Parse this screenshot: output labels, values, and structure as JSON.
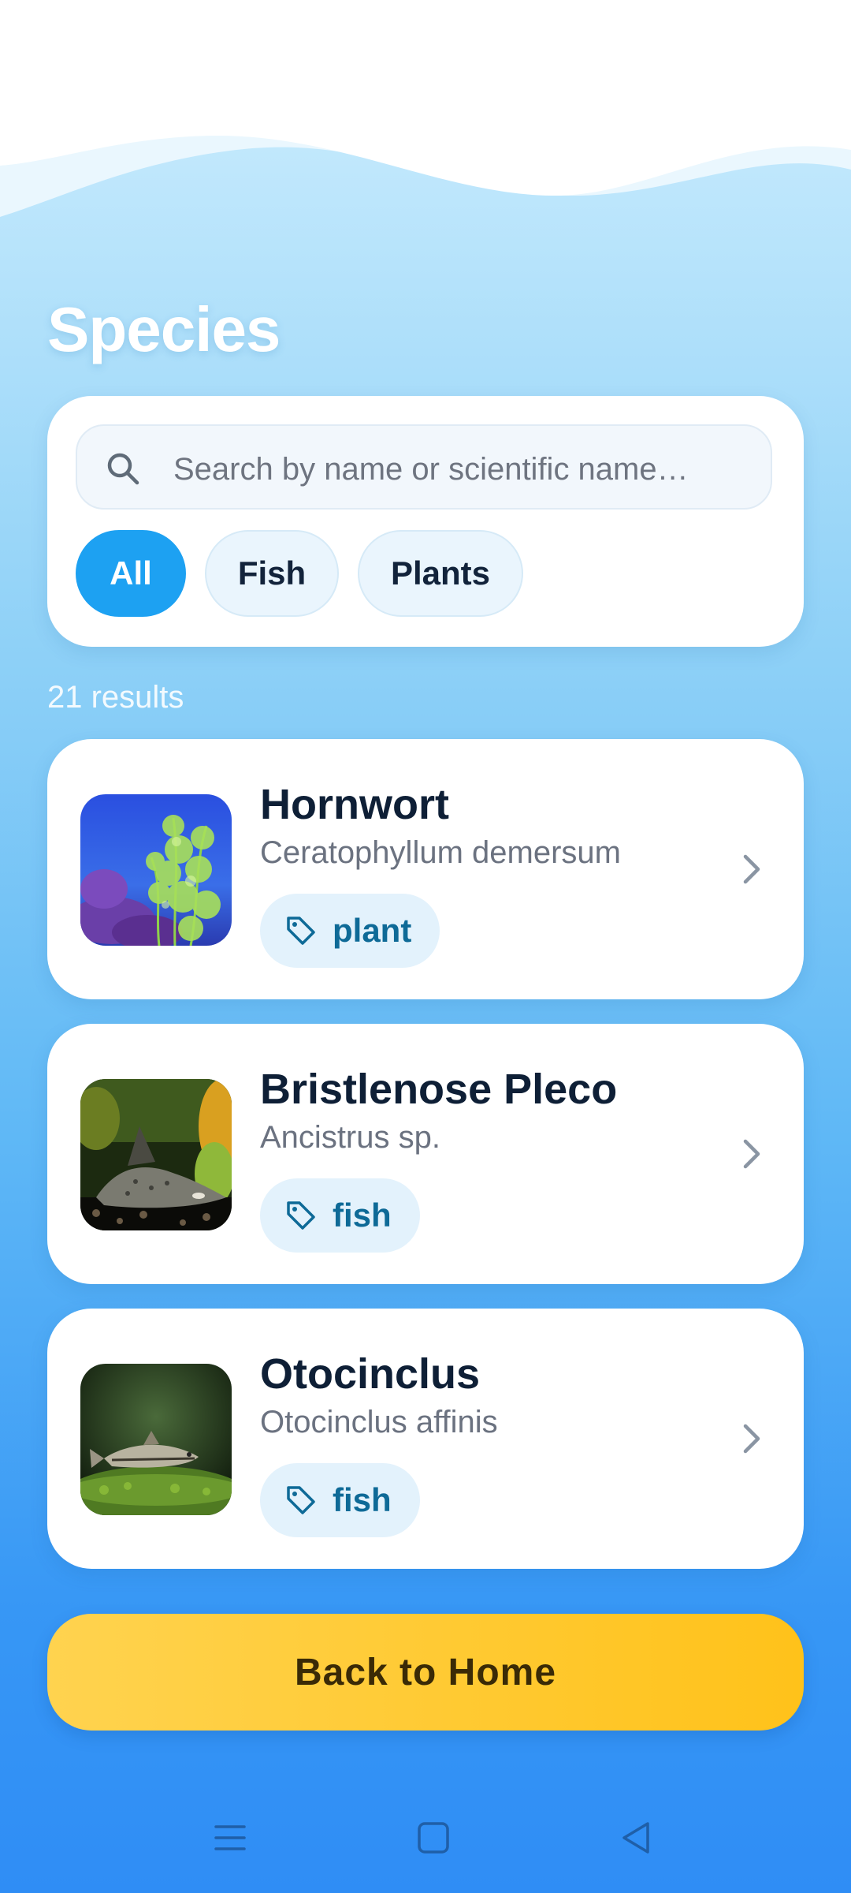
{
  "header": {
    "title": "Species"
  },
  "search": {
    "placeholder": "Search by name or scientific name…",
    "value": ""
  },
  "filters": [
    {
      "label": "All",
      "active": true
    },
    {
      "label": "Fish",
      "active": false
    },
    {
      "label": "Plants",
      "active": false
    }
  ],
  "results": {
    "count_text": "21 results",
    "items": [
      {
        "name": "Hornwort",
        "scientific": "Ceratophyllum demersum",
        "tag": "plant"
      },
      {
        "name": "Bristlenose Pleco",
        "scientific": "Ancistrus sp.",
        "tag": "fish"
      },
      {
        "name": "Otocinclus",
        "scientific": "Otocinclus affinis",
        "tag": "fish"
      }
    ]
  },
  "actions": {
    "back_label": "Back to Home"
  },
  "icons": {
    "search": "search-icon",
    "tag": "tag-icon",
    "chevron": "chevron-right-icon",
    "nav_menu": "menu-icon",
    "nav_home": "home-square-icon",
    "nav_back": "back-triangle-icon"
  },
  "colors": {
    "accent": "#1da1f2",
    "button": "#ffc21a",
    "title_text": "#ffffff",
    "card_title": "#0e1f36",
    "tag_text": "#0e6a97"
  }
}
